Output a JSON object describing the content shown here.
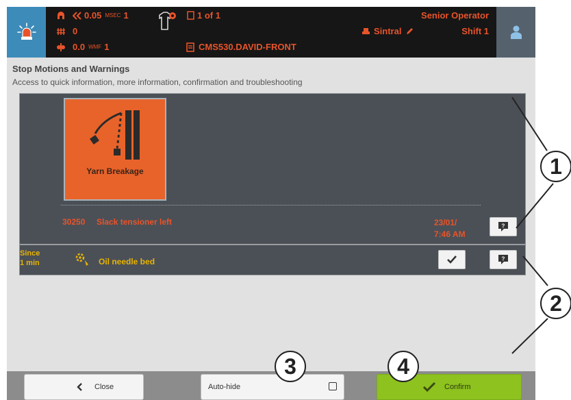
{
  "topbar": {
    "speed_value": "0.05",
    "speed_unit": "MSEC",
    "speed_count": "1",
    "yarn_value": "0",
    "takedown_value": "0.0",
    "takedown_unit": "WMF",
    "takedown_count": "1",
    "pattern_count": "1 of 1",
    "program_name": "CMS530.DAVID-FRONT",
    "role": "Senior Operator",
    "software": "Sintral",
    "shift": "Shift 1"
  },
  "heading": {
    "title": "Stop Motions and Warnings",
    "subtitle": "Access to quick information, more information, confirmation and troubleshooting"
  },
  "stop_motion": {
    "tile_label": "Yarn Breakage",
    "code": "30250",
    "message": "Slack tensioner left",
    "date": "23/01/",
    "time": "7:46 AM"
  },
  "warning": {
    "since_line1": "Since",
    "since_line2": "1 min",
    "message": "Oil needle bed"
  },
  "footer": {
    "close_label": "Close",
    "autohide_label": "Auto-hide",
    "confirm_label": "Confirm"
  },
  "callouts": [
    "1",
    "2",
    "3",
    "4"
  ],
  "colors": {
    "alarm": "#e8542a",
    "warning": "#e8b400",
    "accent_blue": "#3d8bb9",
    "confirm_green": "#8dc21f"
  }
}
